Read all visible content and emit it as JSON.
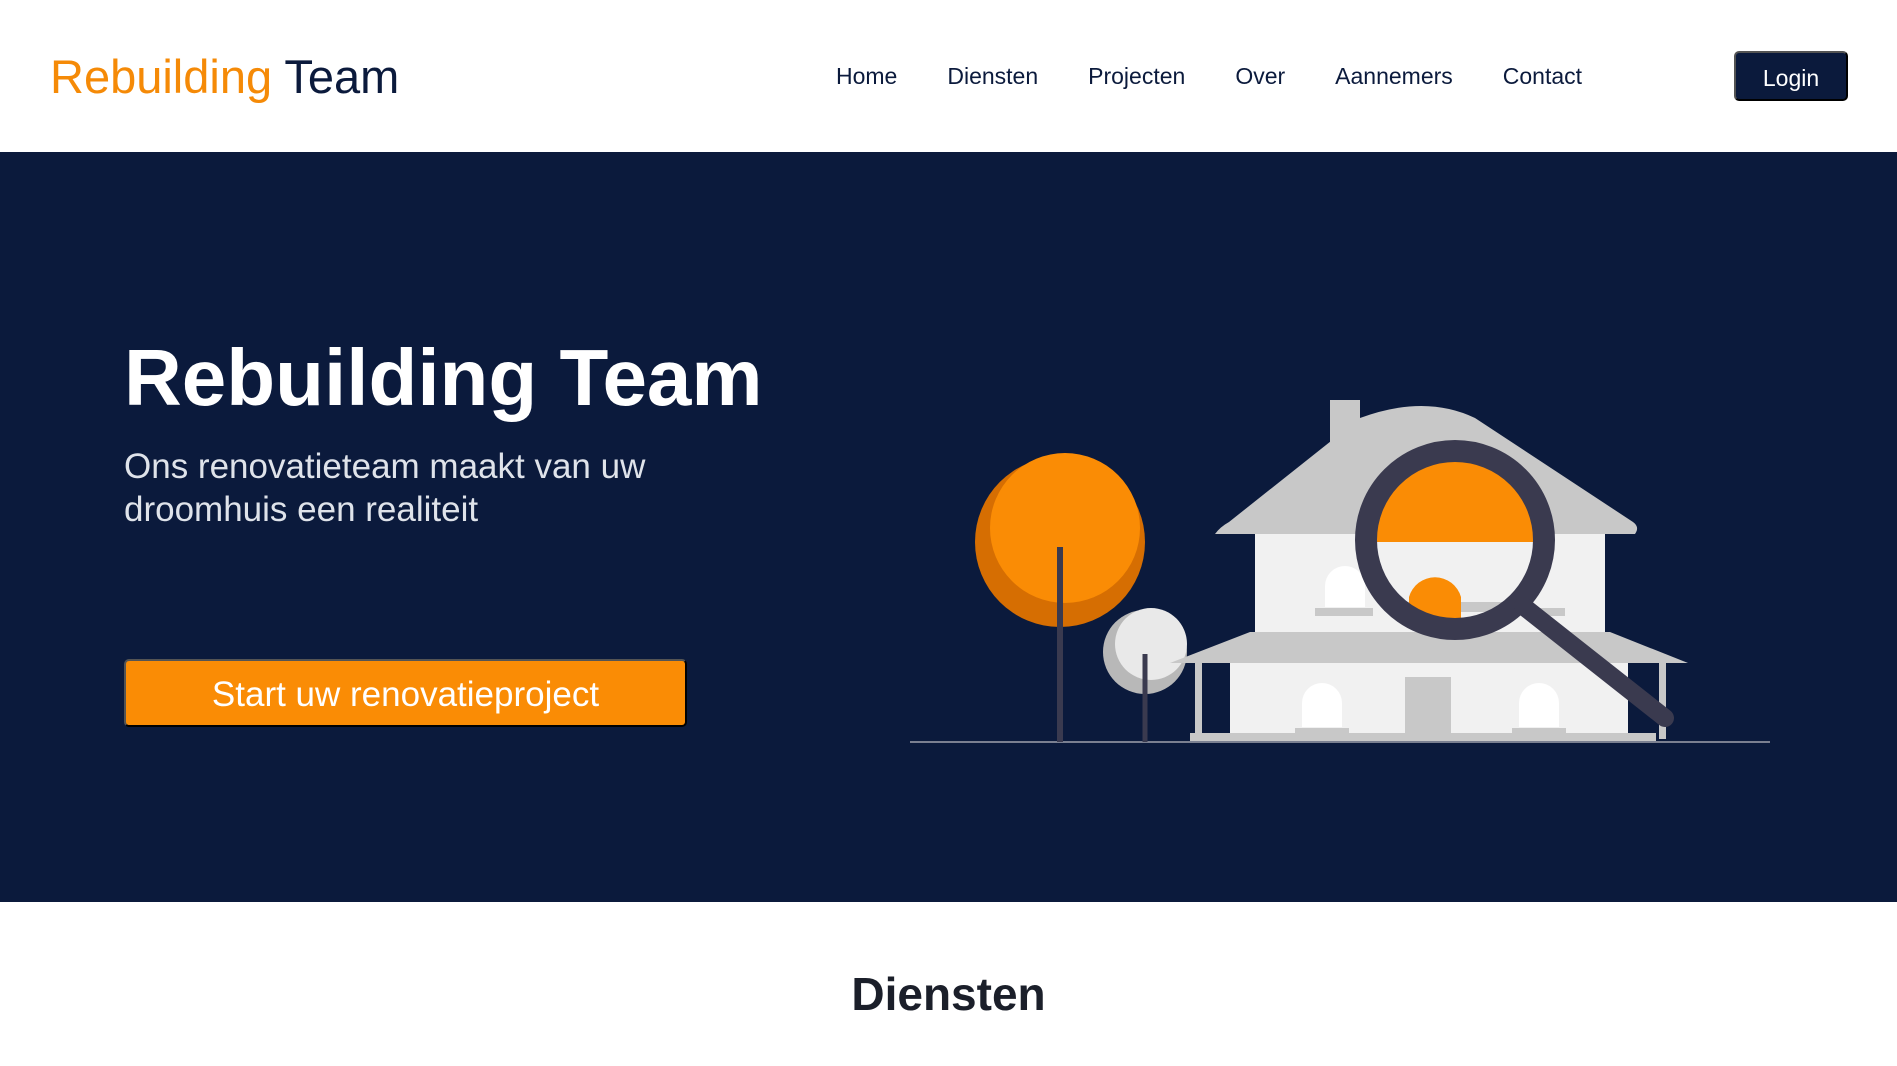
{
  "header": {
    "logo_part1": "Rebuilding",
    "logo_part2": "Team",
    "nav": [
      "Home",
      "Diensten",
      "Projecten",
      "Over",
      "Aannemers",
      "Contact"
    ],
    "login_label": "Login"
  },
  "hero": {
    "title": "Rebuilding Team",
    "subtitle": "Ons renovatieteam maakt van uw droomhuis een realiteit",
    "cta_label": "Start uw renovatieproject"
  },
  "illustration": {
    "icon": "house-magnifier-illustration"
  },
  "sections": {
    "services_title": "Diensten"
  },
  "colors": {
    "brand_orange": "#f58a07",
    "navy": "#0b1a3c",
    "cta_orange": "#fa8c05",
    "house_gray": "#c8c8c8",
    "house_wall": "#f1f1f1",
    "magnifier": "#3a3a4f"
  }
}
